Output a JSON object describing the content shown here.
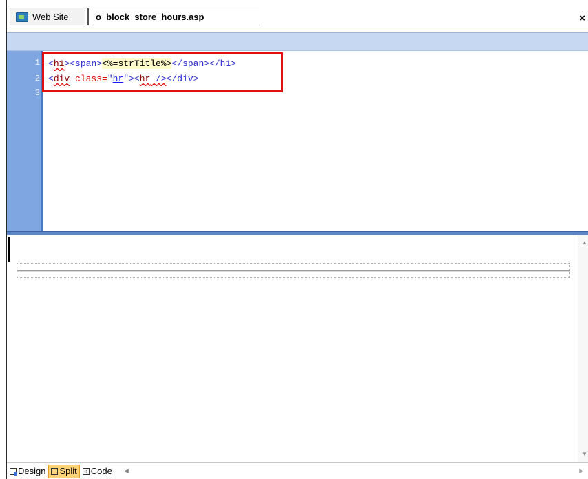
{
  "tabs": [
    {
      "label": "Web Site",
      "icon": "website-folder-icon"
    },
    {
      "label": "o_block_store_hours.asp",
      "active": true
    }
  ],
  "close_label": "×",
  "editor": {
    "line_numbers": [
      "1",
      "2",
      "3"
    ],
    "lines": {
      "l1": {
        "open_h1": "<",
        "h1": "h1",
        "gt1": ">",
        "span_open": "<span>",
        "asp": "<%=strTitle%>",
        "span_close": "</span></h1>"
      },
      "l2": {
        "lt": "<",
        "div": "div",
        "attr": " class=",
        "q1": "\"",
        "val": "hr",
        "q2": "\"",
        "gt": ">",
        "lt2": "<",
        "hr": "hr",
        "slash": " />",
        "close": "</div>"
      }
    }
  },
  "viewbar": {
    "design": "Design",
    "split": "Split",
    "code": "Code",
    "active": "Split"
  },
  "colors": {
    "gutter": "#7fa6e0",
    "toolbar": "#c7d9f2",
    "highlight": "#e01010",
    "active_view": "#ffd27a"
  }
}
